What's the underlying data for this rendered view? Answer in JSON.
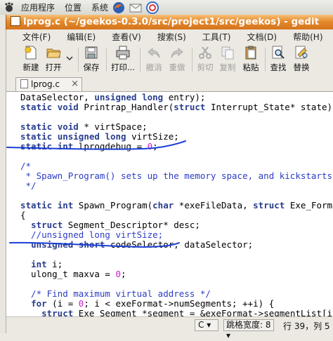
{
  "panel": {
    "menus": [
      "应用程序",
      "位置",
      "系统"
    ]
  },
  "window": {
    "title": "lprog.c (~/geekos-0.3.0/src/project1/src/geekos) - gedit"
  },
  "menubar": {
    "items": [
      "文件(F)",
      "编辑(E)",
      "查看(V)",
      "搜索(S)",
      "工具(T)",
      "文档(D)",
      "帮助(H)"
    ]
  },
  "toolbar": {
    "new_label": "新建",
    "open_label": "打开",
    "save_label": "保存",
    "print_label": "打印...",
    "undo_label": "撤消",
    "redo_label": "重做",
    "cut_label": "剪切",
    "copy_label": "复制",
    "paste_label": "粘贴",
    "find_label": "查找",
    "replace_label": "替换"
  },
  "tab": {
    "label": "lprog.c"
  },
  "code": {
    "lines": [
      "DataSelector, unsigned long entry);",
      "static void Printrap_Handler(struct Interrupt_State* state);",
      "",
      "static void * virtSpace;",
      "static unsigned long virtSize;",
      "static int lprogdebug = 0;",
      "",
      "/*",
      " * Spawn_Program() sets up the memory space, and kickstarts the prog",
      " */",
      "",
      "static int Spawn_Program(char *exeFileData, struct Exe_Format *exeFo",
      "{",
      "  struct Segment_Descriptor* desc;",
      "  //unsigned long virtSize;",
      "  unsigned short codeSelector, dataSelector;",
      "",
      "  int i;",
      "  ulong_t maxva = 0;",
      "",
      "  /* Find maximum virtual address */",
      "  for (i = 0; i < exeFormat->numSegments; ++i) {",
      "    struct Exe_Segment *segment = &exeFormat->segmentList[i];"
    ]
  },
  "statusbar": {
    "language": "C",
    "tab_width": "跳格宽度: 8",
    "position": "行 39，列 5"
  },
  "colors": {
    "title_bar": "#e58a2c",
    "keyword": "#2a3e8c",
    "type": "#1f6f1f",
    "comment": "#2c3cc4",
    "number": "#d21bd2",
    "annotation_ink": "#1a3fd6"
  }
}
